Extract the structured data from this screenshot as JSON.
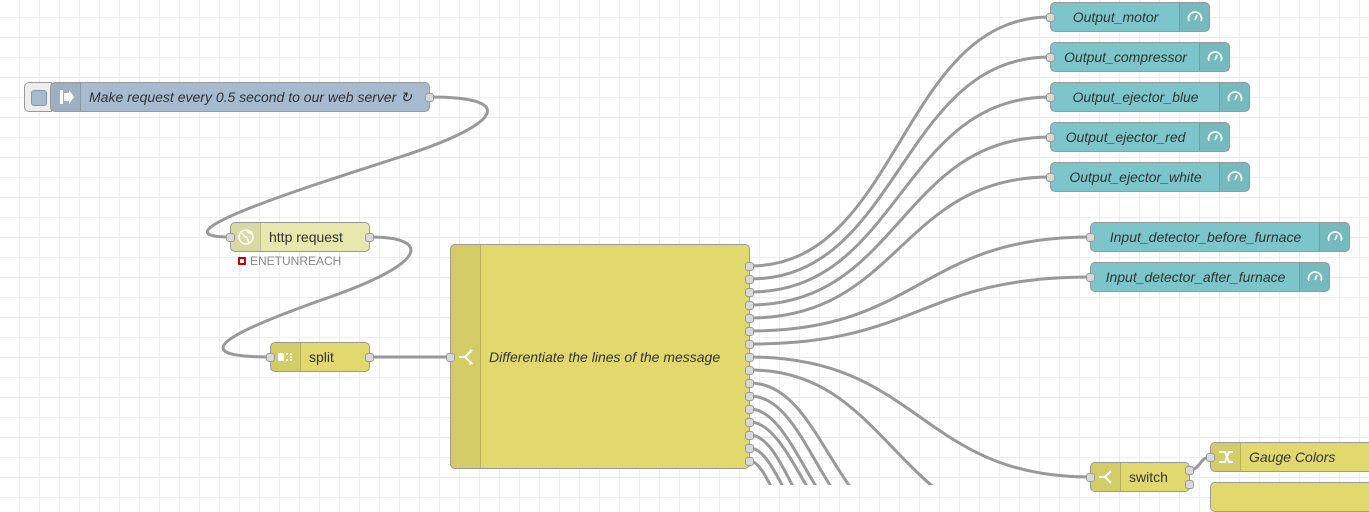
{
  "inject": {
    "label": "Make request every 0.5 second to our web server ↻",
    "icon": "inject-arrow-icon",
    "color": "#a6bbcf"
  },
  "http_request": {
    "label": "http request",
    "icon": "globe-icon",
    "status": "ENETUNREACH",
    "status_color": "#cc0000"
  },
  "split": {
    "label": "split",
    "icon": "split-icon"
  },
  "function": {
    "label": "Differentiate the lines of the message",
    "icon": "function-switch-icon",
    "color": "#e2d96e"
  },
  "outputs": [
    "Output_motor",
    "Output_compressor",
    "Output_ejector_blue",
    "Output_ejector_red",
    "Output_ejector_white"
  ],
  "inputs": [
    "Input_detector_before_furnace",
    "Input_detector_after_furnace"
  ],
  "ui_node": {
    "icon": "gauge-icon",
    "color": "#7cc6cb"
  },
  "switch_node": {
    "label": "switch",
    "icon": "switch-icon"
  },
  "change_node": {
    "label": "Gauge Colors",
    "icon": "change-icon"
  }
}
